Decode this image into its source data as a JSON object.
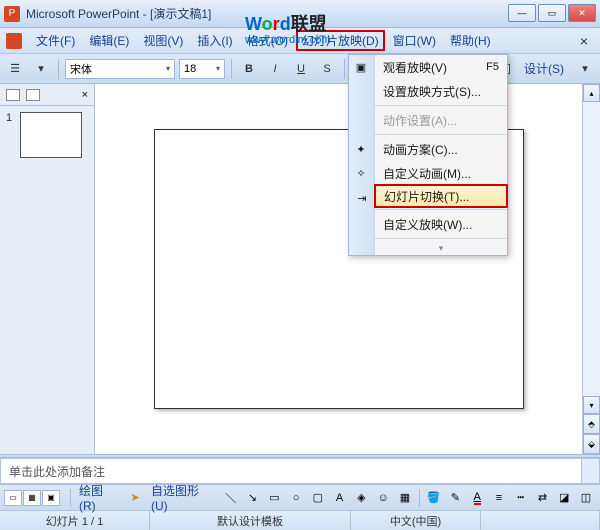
{
  "title": "Microsoft PowerPoint - [演示文稿1]",
  "watermark": {
    "w": "W",
    "o": "o",
    "r": "r",
    "d": "d",
    "cn": "联盟",
    "url": "www.wordlm.com"
  },
  "menubar": {
    "file": "文件(F)",
    "edit": "编辑(E)",
    "view": "视图(V)",
    "insert": "插入(I)",
    "format": "格式(O)",
    "slideshow": "幻灯片放映(D)",
    "window": "窗口(W)",
    "help": "帮助(H)"
  },
  "toolbar": {
    "font": "宋体",
    "size": "18",
    "bold": "B",
    "italic": "I",
    "underline": "U",
    "shadow": "S",
    "design": "设计(S)"
  },
  "dropdown": {
    "view_show": "观看放映(V)",
    "view_show_key": "F5",
    "setup_show": "设置放映方式(S)...",
    "action_settings": "动作设置(A)...",
    "animation_schemes": "动画方案(C)...",
    "custom_animation": "自定义动画(M)...",
    "slide_transition": "幻灯片切换(T)...",
    "custom_shows": "自定义放映(W)..."
  },
  "thumbnail": {
    "num": "1"
  },
  "notes": {
    "placeholder": "单击此处添加备注"
  },
  "draw_toolbar": {
    "draw": "绘图(R)",
    "autoshapes": "自选图形(U)"
  },
  "statusbar": {
    "slide": "幻灯片 1 / 1",
    "template": "默认设计模板",
    "lang": "中文(中国)"
  }
}
